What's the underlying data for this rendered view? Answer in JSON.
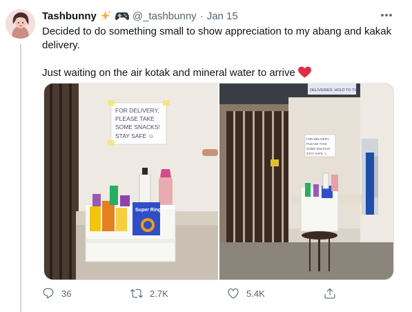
{
  "tweet": {
    "author_name": "Tashbunny",
    "name_emojis": [
      "sparkles-emoji",
      "game-controller-emoji"
    ],
    "handle": "@_tashbunny",
    "separator": "·",
    "date": "Jan 15",
    "text_line1": "Decided to do something small to show appreciation to my abang and kakak delivery.",
    "text_line2": "Just waiting on the air kotak and mineral water to arrive",
    "text_emoji": "red-heart-emoji",
    "media": [
      {
        "sign_lines": [
          "FOR DELIVERY,",
          "PLEASE TAKE",
          "SOME SNACKS!",
          "STAY SAFE ☺"
        ],
        "snack_label": "Super Ring"
      },
      {
        "sign_lines": [
          "FOR DELIVERY,",
          "PLEASE TAKE",
          "SOME SNACKS!",
          "STAY SAFE ☺"
        ],
        "top_notice": "DELIVERIES: HOLD TO THE"
      }
    ],
    "actions": {
      "reply_count": "36",
      "retweet_count": "2.7K",
      "like_count": "5.4K",
      "share_label": ""
    },
    "colors": {
      "text": "#0f1419",
      "secondary": "#536471",
      "heart": "#e0245e",
      "gold": "#ffac33"
    },
    "icons": {
      "more": "more-horizontal-icon",
      "reply": "reply-icon",
      "retweet": "retweet-icon",
      "like": "heart-outline-icon",
      "share": "share-icon"
    }
  }
}
